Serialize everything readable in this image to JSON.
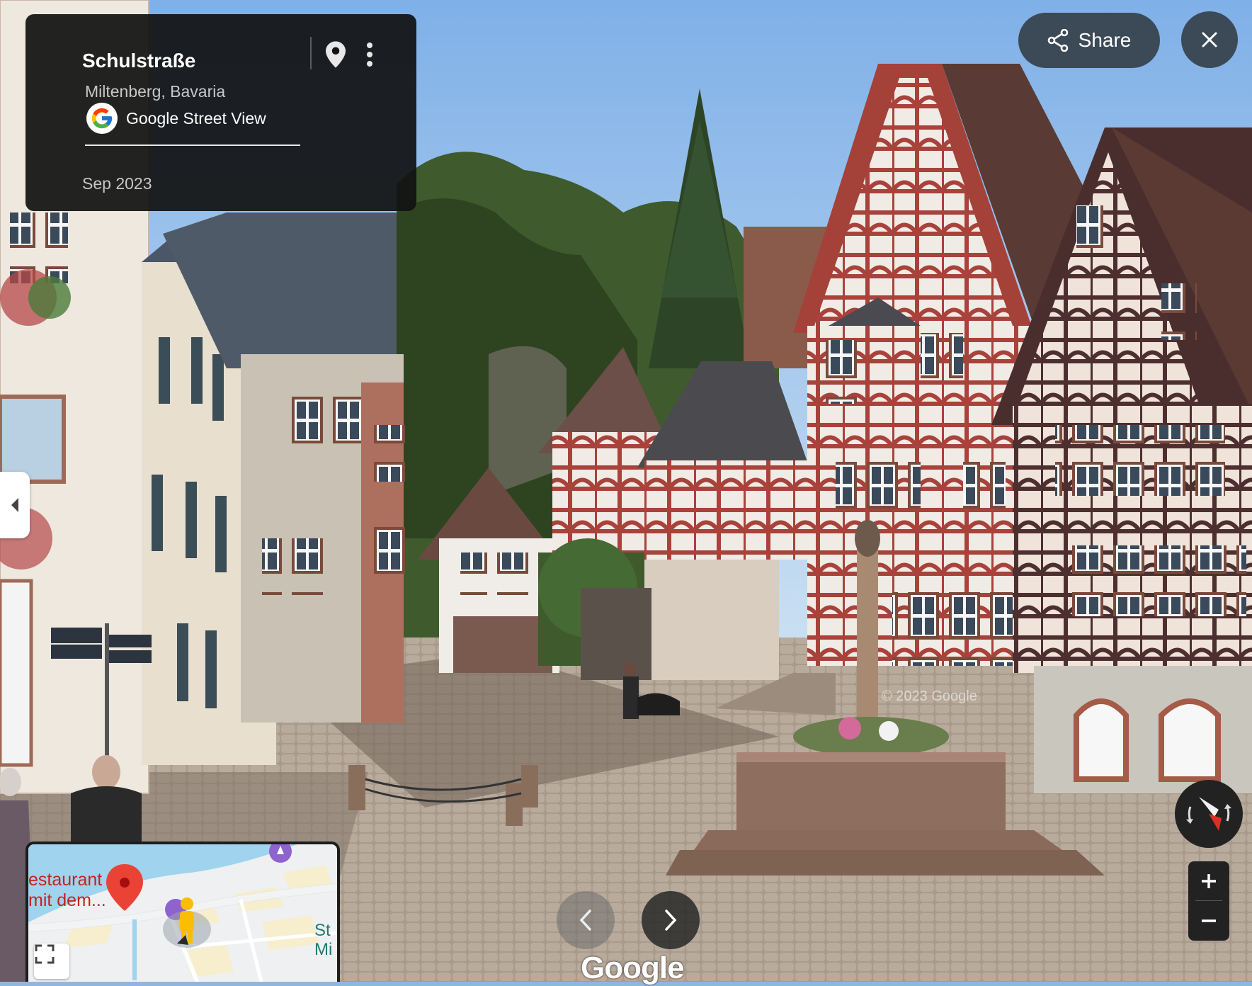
{
  "location": {
    "title": "Schulstraße",
    "subtitle": "Miltenberg, Bavaria",
    "source": "Google Street View",
    "date": "Sep 2023"
  },
  "buttons": {
    "share_label": "Share"
  },
  "watermark": "Google",
  "scene_watermark": "© 2023 Google",
  "minimap": {
    "restaurant_label_line1": "estaurant",
    "restaurant_label_line2": "mit dem...",
    "edge_label_line1": "St",
    "edge_label_line2": "Mi"
  },
  "icons": {
    "pin": "location-pin-icon",
    "more": "more-vert-icon",
    "share": "share-icon",
    "close": "close-icon",
    "collapse": "chevron-left-icon",
    "compass": "compass-icon",
    "zoom_in": "plus-icon",
    "zoom_out": "minus-icon",
    "prev": "chevron-left-icon",
    "next": "chevron-right-icon",
    "expand": "fullscreen-icon",
    "pegman": "pegman-icon"
  },
  "colors": {
    "sky": "#8fb6e0",
    "timber_red": "#a63a30",
    "timber_dark": "#4a2a2a",
    "card_bg": "#121212",
    "button_bg": "#3c4a57",
    "map_marker": "#ea4335"
  }
}
